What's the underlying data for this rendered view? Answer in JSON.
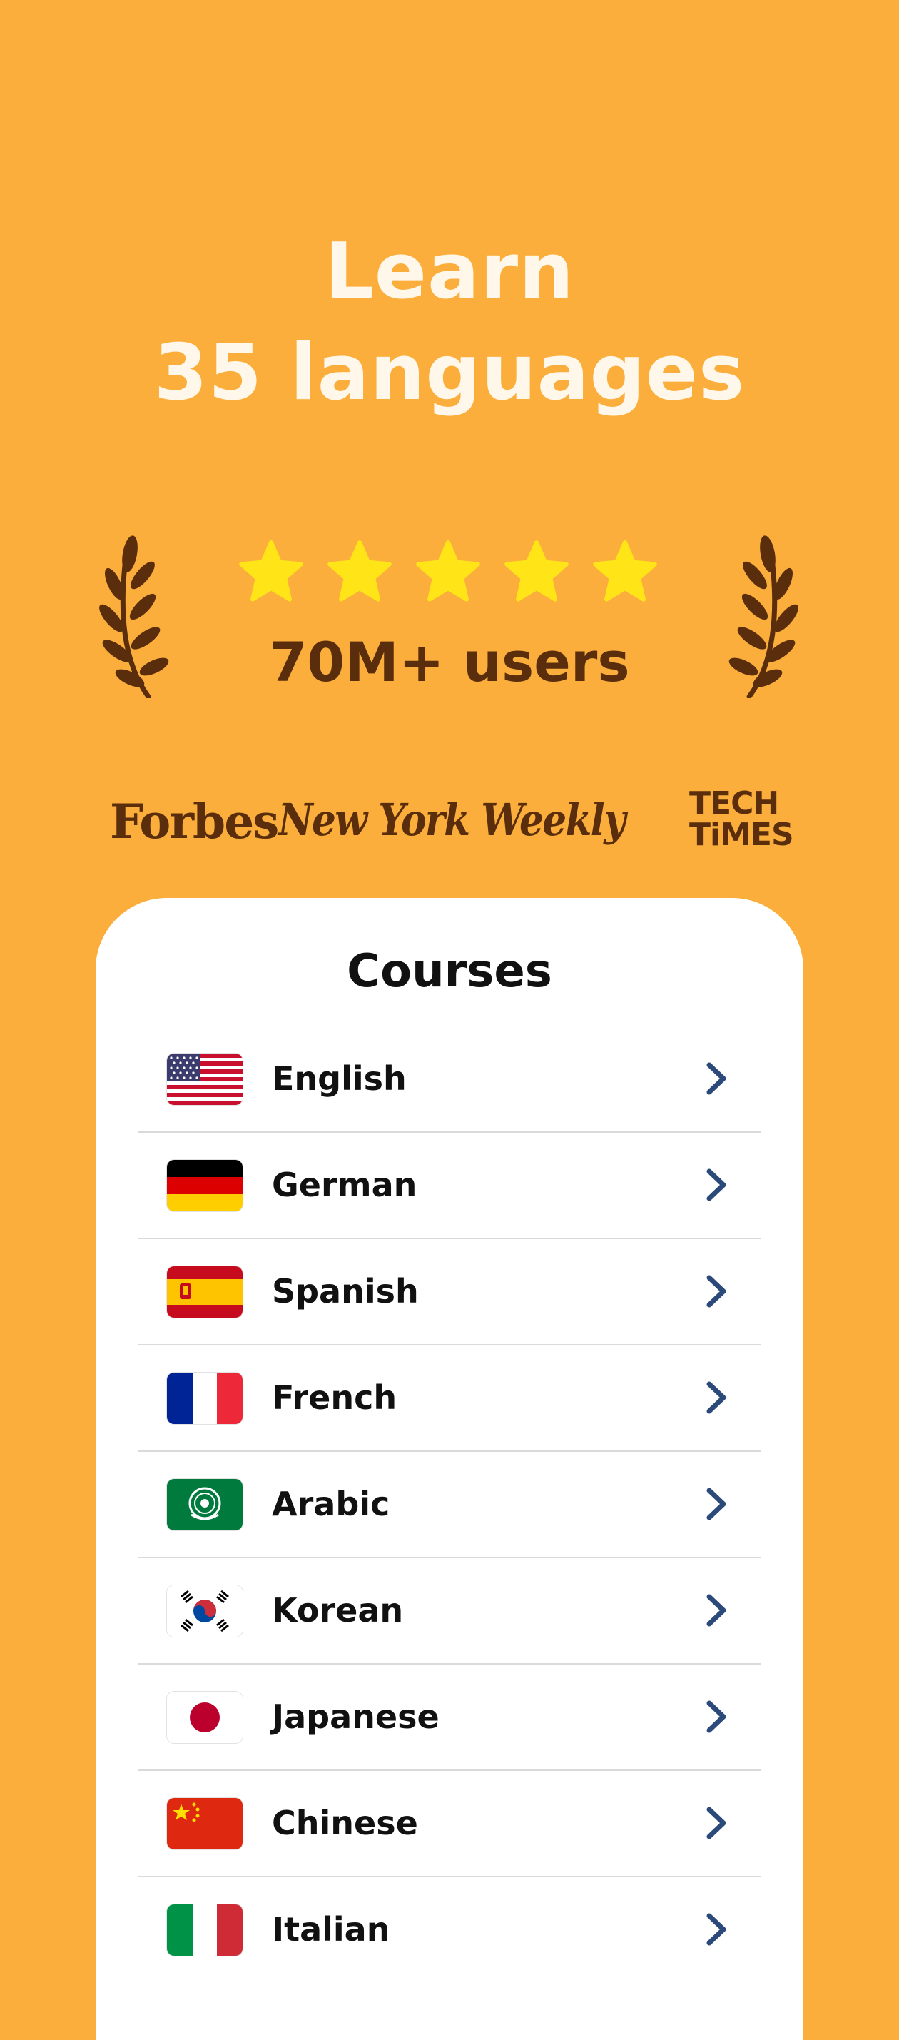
{
  "headline": {
    "line1": "Learn",
    "line2": "35 languages"
  },
  "rating": {
    "stars": 5,
    "users_text": "70M+ users"
  },
  "press": {
    "forbes": "Forbes",
    "nyw": "New York Weekly",
    "tt_line1": "TECH",
    "tt_line2": "TiMES"
  },
  "courses": {
    "title": "Courses",
    "items": [
      {
        "label": "English",
        "flag": "us-flag-icon"
      },
      {
        "label": "German",
        "flag": "germany-flag-icon"
      },
      {
        "label": "Spanish",
        "flag": "spain-flag-icon"
      },
      {
        "label": "French",
        "flag": "france-flag-icon"
      },
      {
        "label": "Arabic",
        "flag": "arab-league-flag-icon"
      },
      {
        "label": "Korean",
        "flag": "korea-flag-icon"
      },
      {
        "label": "Japanese",
        "flag": "japan-flag-icon"
      },
      {
        "label": "Chinese",
        "flag": "china-flag-icon"
      },
      {
        "label": "Italian",
        "flag": "italy-flag-icon"
      }
    ]
  },
  "colors": {
    "background": "#FBAE3C",
    "accent_brown": "#5A2E0C",
    "star": "#FFE418",
    "chevron": "#2B4A7A"
  }
}
